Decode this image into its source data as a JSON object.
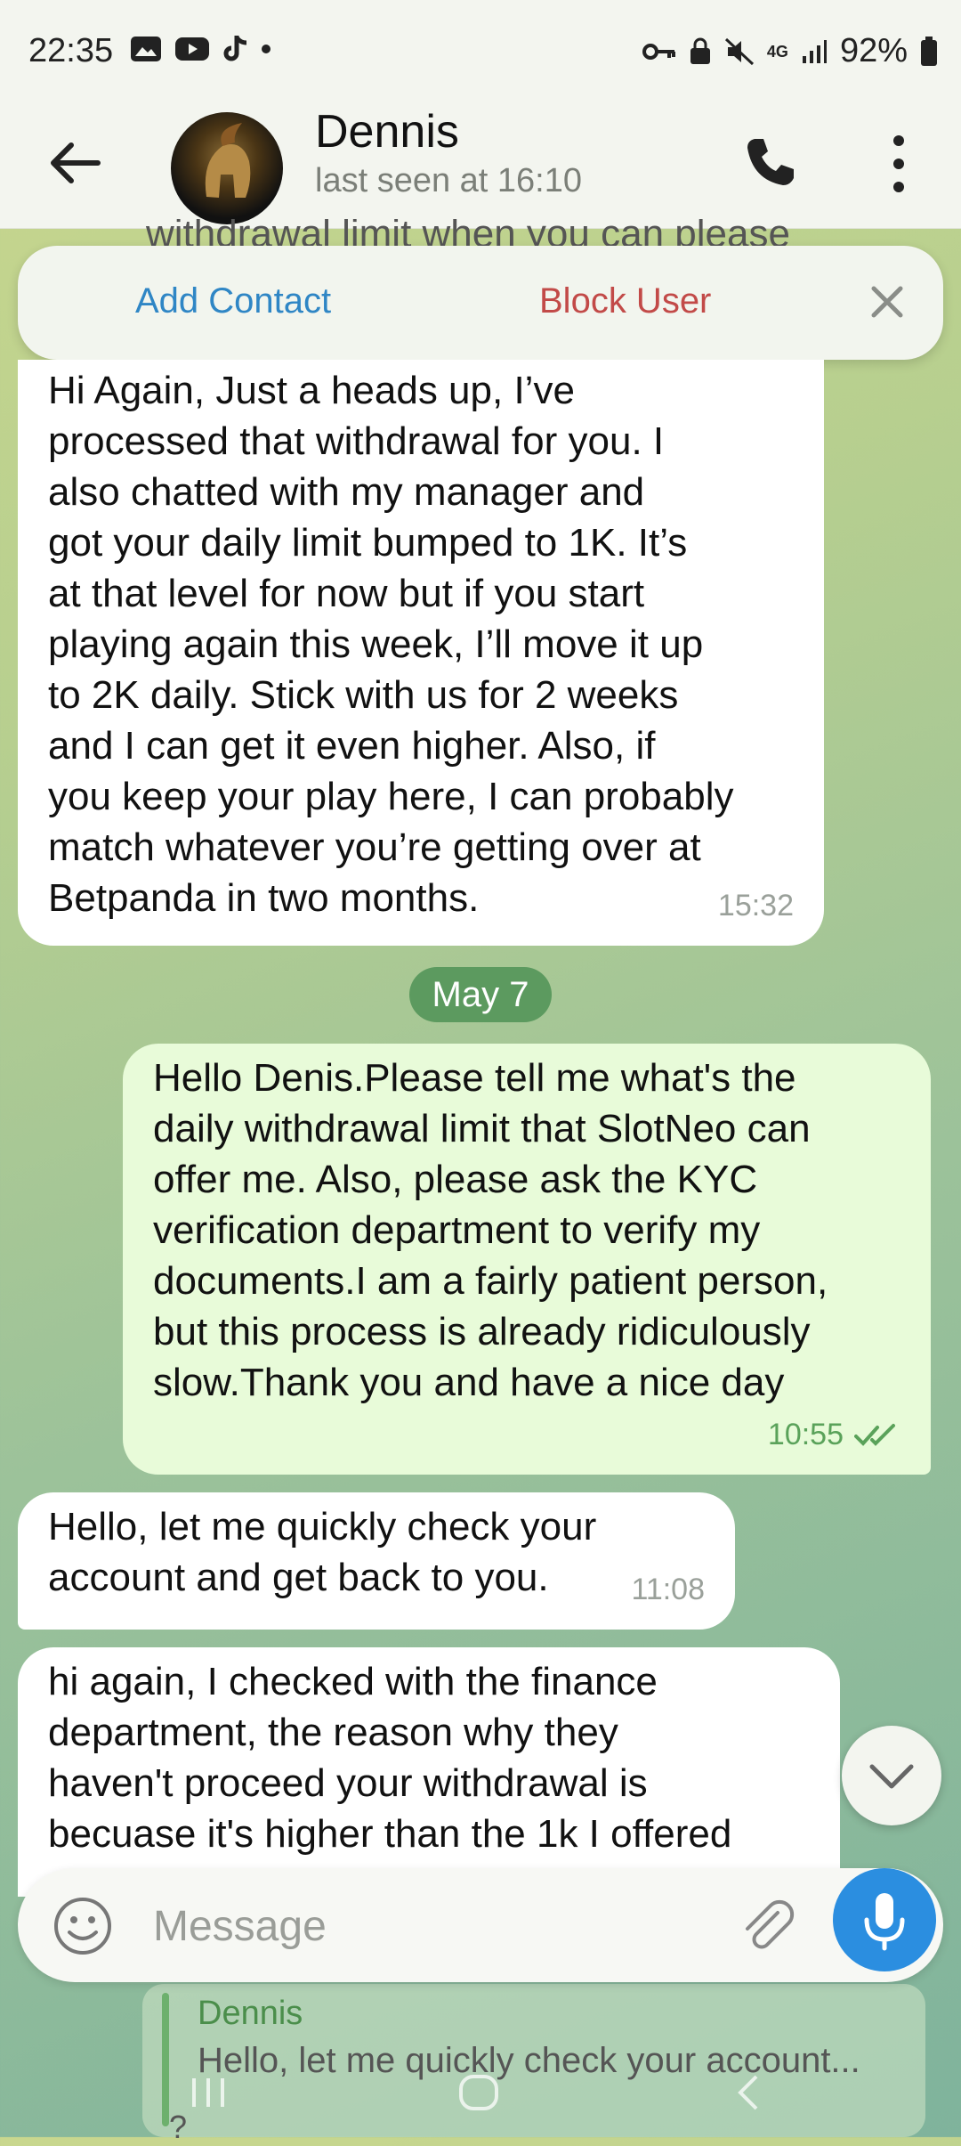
{
  "status_bar": {
    "time": "22:35",
    "battery": "92%",
    "network": "4G",
    "left_icons": [
      "gallery-icon",
      "youtube-icon",
      "tiktok-icon"
    ],
    "right_icons": [
      "key-icon",
      "lock-icon",
      "mute-icon",
      "signal-icon",
      "battery-icon"
    ]
  },
  "header": {
    "name": "Dennis",
    "status": "last seen at 16:10"
  },
  "top_partial_text": "withdrawal limit when you can please",
  "actions": {
    "add_contact": "Add Contact",
    "block_user": "Block User"
  },
  "messages": [
    {
      "direction": "in",
      "text_lines": [
        "Hi Again, Just a heads up, I’ve",
        "processed that withdrawal for you. I",
        "also chatted with my manager and",
        "got your daily limit bumped to 1K. It’s",
        "at that level for now but if you start",
        "playing again this week, I’ll move it up",
        "to 2K daily. Stick with us for 2 weeks",
        "and I can get it even higher. Also, if",
        "you keep your play here, I can probably",
        "match whatever you’re getting over at",
        "Betpanda in two months."
      ],
      "time": "15:32"
    },
    {
      "direction": "out",
      "text_lines": [
        "Hello Denis.Please tell me what's the",
        "daily withdrawal limit that SlotNeo can",
        "offer me. Also, please ask the KYC",
        "verification department to verify my",
        "documents.I am a fairly patient person,",
        "but this process is already ridiculously",
        "slow.Thank you and have a nice day"
      ],
      "time": "10:55",
      "read": true
    },
    {
      "direction": "in",
      "text_lines": [
        "Hello, let me quickly check your",
        "account and get back to you."
      ],
      "time": "11:08"
    },
    {
      "direction": "in",
      "text_lines": [
        "hi again, I checked with the finance",
        "department, the reason why they",
        "haven't proceed your withdrawal is",
        "becuase it's higher than the 1k I offered"
      ],
      "time": ""
    }
  ],
  "date_separator": "May 7",
  "composer": {
    "placeholder": "Message"
  },
  "quote": {
    "name": "Dennis",
    "text": "Hello, let me quickly check your account...",
    "extra": "?"
  },
  "colors": {
    "accent": "#2b8ee0",
    "block": "#c24a48",
    "add": "#2f86c5",
    "outgoing_bubble": "#e8fbd9",
    "date_pill": "#5c9a5f"
  }
}
